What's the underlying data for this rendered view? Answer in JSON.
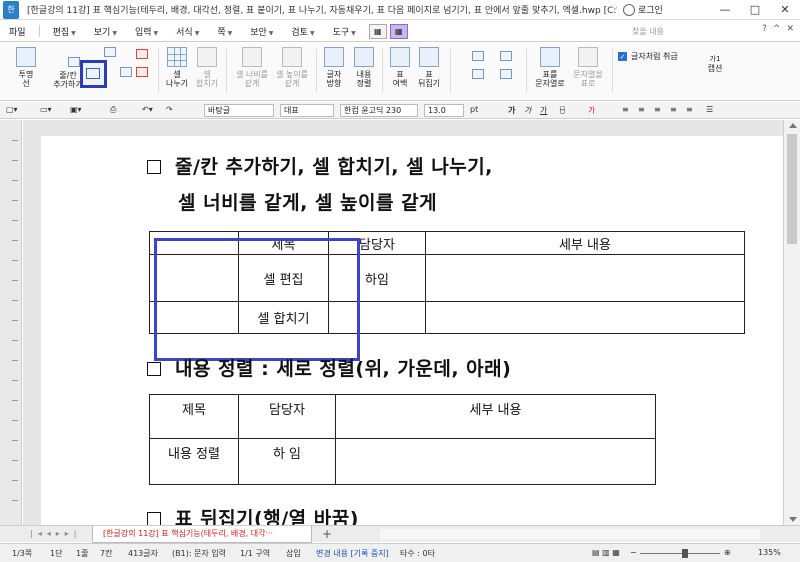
{
  "titlebar": {
    "app_icon": "한",
    "title": "[한글강의 11강] 표 핵심기능(테두리, 배경, 대각선, 정렬, 표 붙이기, 표 나누기, 자동채우기, 표 다음 페이지로 넘기기, 표 안에서 앞줄 맞추기, 엑셀.hwp [C:₩Users₩user···",
    "login": "로그인",
    "minimize": "—",
    "maximize": "□",
    "close": "✕"
  },
  "menubar": {
    "items": [
      "파일",
      "편집",
      "보기",
      "입력",
      "서식",
      "쪽",
      "보안",
      "검토",
      "도구"
    ],
    "search_placeholder": "찾을 내용",
    "right_icons": [
      "?",
      "^",
      "✕"
    ]
  },
  "ribbon": {
    "buttons": [
      {
        "label1": "투명",
        "label2": "선"
      },
      {
        "label1": "줄/칸",
        "label2": "추가하기"
      },
      {
        "label1": "셀",
        "label2": "나누기"
      },
      {
        "label1": "셀",
        "label2": "합치기"
      },
      {
        "label1": "셀 너비를",
        "label2": "같게"
      },
      {
        "label1": "셀 높이를",
        "label2": "같게"
      },
      {
        "label1": "글자",
        "label2": "방향"
      },
      {
        "label1": "내용",
        "label2": "정렬"
      },
      {
        "label1": "표",
        "label2": "여백"
      },
      {
        "label1": "표",
        "label2": "뒤집기"
      },
      {
        "label1": "표를",
        "label2": "문자열로"
      },
      {
        "label1": "문자열을",
        "label2": "표로"
      },
      {
        "label1": "캡션",
        "label2": ""
      }
    ],
    "checkbox_label": "글자처럼 취급",
    "caption_top": "가1"
  },
  "fmtbar": {
    "style": "바탕글",
    "lang": "대표",
    "font": "한컴 윤고딕 230",
    "size": "13.0",
    "unit": "pt",
    "bold": "가",
    "italic": "가",
    "underline": "가"
  },
  "document": {
    "heading1_line1": "줄/칸 추가하기, 셀 합치기, 셀 나누기,",
    "heading1_line2": "셀 너비를 같게, 셀 높이를 같게",
    "table1": {
      "header": [
        "제목",
        "담당자",
        "세부 내용"
      ],
      "row1": [
        "셀 편집",
        "하임",
        ""
      ],
      "row2": [
        "셀 합치기",
        "",
        ""
      ]
    },
    "heading2": "내용 정렬 : 세로 정렬(위, 가운데, 아래)",
    "table2": {
      "header": [
        "제목",
        "담당자",
        "세부 내용"
      ],
      "row1": [
        "내용 정렬",
        "하 임",
        ""
      ]
    },
    "heading3": "표 뒤집기(행/열 바꿈)"
  },
  "tabbar": {
    "tab_title": "[한글강의 11강] 표 핵심기능(테두리, 배경, 대각···",
    "add": "+"
  },
  "statusbar": {
    "page": "1/3쪽",
    "section": "1단",
    "line": "1줄",
    "column": "7칸",
    "chars": "413글자",
    "cell": "(B1): 문자 입력",
    "area": "1/1 구역",
    "mode": "삽입",
    "track": "변경 내용 [기록 중지]",
    "count": "타수 : 0타",
    "zoom": "135%"
  }
}
